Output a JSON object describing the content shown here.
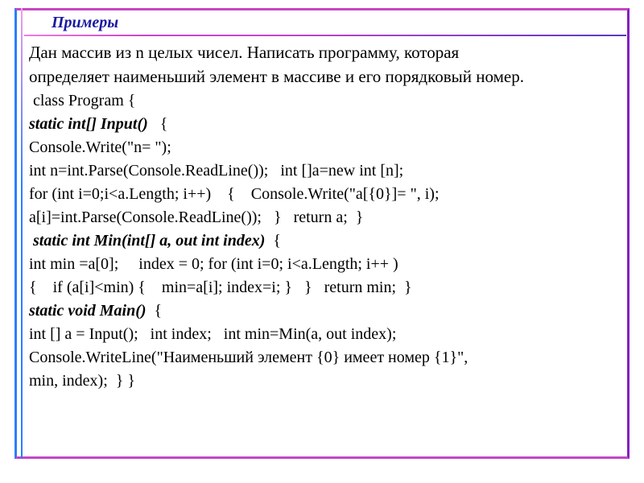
{
  "header": {
    "title": "Примеры"
  },
  "desc": {
    "line1": "Дан массив из n целых чисел. Написать программу, которая",
    "line2": "определяет наименьший элемент в массиве и его порядковый номер."
  },
  "code": {
    "l1": " class Program {",
    "l2a": "static int[] Input() ",
    "l2b": "  {",
    "l3": "Console.Write(\"n= \");",
    "l4": "int n=int.Parse(Console.ReadLine());   int []a=new int [n];",
    "l5": "for (int i=0;i<a.Length; i++)    {    Console.Write(\"a[{0}]= \", i);",
    "l6": "a[i]=int.Parse(Console.ReadLine());   }   return a;  }",
    "l7a": " static int Min(int[] a, out int index)",
    "l7b": "  {",
    "l8": "int min =a[0];     index = 0; for (int i=0; i<a.Length; i++ )",
    "l9": "{    if (a[i]<min) {    min=a[i]; index=i; }   }   return min;  }",
    "l10a": "static void Main()",
    "l10b": "  {",
    "l11": "int [] a = Input();   int index;   int min=Min(a, out index);",
    "l12": "Console.WriteLine(\"Наименьший элемент {0} имеет номер {1}\",",
    "l13": "min, index);  } }"
  }
}
